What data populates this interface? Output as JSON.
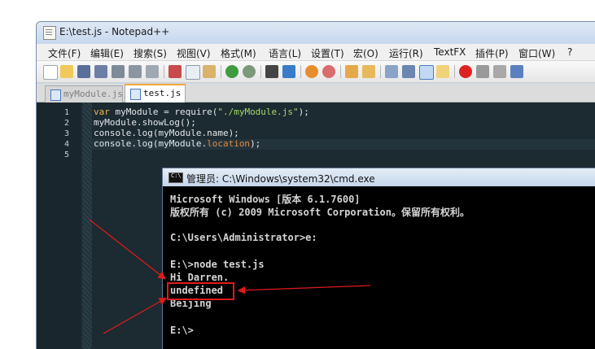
{
  "notepad": {
    "title": "E:\\test.js - Notepad++",
    "menu": [
      "文件(F)",
      "编辑(E)",
      "搜索(S)",
      "视图(V)",
      "格式(M)",
      "语言(L)",
      "设置(T)",
      "宏(O)",
      "运行(R)",
      "TextFX",
      "插件(P)",
      "窗口(W)",
      "?"
    ],
    "tabs": [
      {
        "label": "myModule.js",
        "active": false
      },
      {
        "label": "test.js",
        "active": true
      }
    ],
    "line_numbers": [
      "1",
      "2",
      "3",
      "4",
      "5"
    ],
    "code": {
      "line1_a": "var",
      "line1_b": " myModule = require(",
      "line1_c": "\"./myModule.js\"",
      "line1_d": ");",
      "line2": "myModule.showLog();",
      "line3": "console.log(myModule.name);",
      "line4_a": "console.log(myModule.",
      "line4_b": "location",
      "line4_c": ");"
    }
  },
  "cmd": {
    "title": "管理员: C:\\Windows\\system32\\cmd.exe",
    "icon_label": "C:\\",
    "lines": [
      "Microsoft Windows [版本 6.1.7600]",
      "版权所有 (c) 2009 Microsoft Corporation。保留所有权利。",
      "",
      "C:\\Users\\Administrator>e:",
      "",
      "E:\\>node test.js",
      "Hi Darren.",
      "undefined",
      "Beijing",
      "",
      "E:\\>"
    ]
  },
  "colors": {
    "editor_bg": "#1c2a31",
    "keyword": "#f2b54f",
    "string": "#a6d96a",
    "property": "#e08a3c",
    "annotation_red": "#e01b1b"
  },
  "icons": [
    "new-file-icon",
    "open-icon",
    "save-icon",
    "save-all-icon",
    "close-icon",
    "close-all-icon",
    "print-icon",
    "cut-icon",
    "copy-icon",
    "paste-icon",
    "undo-icon",
    "redo-icon",
    "find-icon",
    "replace-icon",
    "zoom-in-icon",
    "zoom-out-icon",
    "sync-v-icon",
    "sync-h-icon",
    "word-wrap-icon",
    "show-all-chars-icon",
    "indent-guide-icon",
    "doc-map-icon",
    "record-macro-icon",
    "stop-macro-icon",
    "play-macro-icon",
    "run-macro-multiple-icon"
  ]
}
